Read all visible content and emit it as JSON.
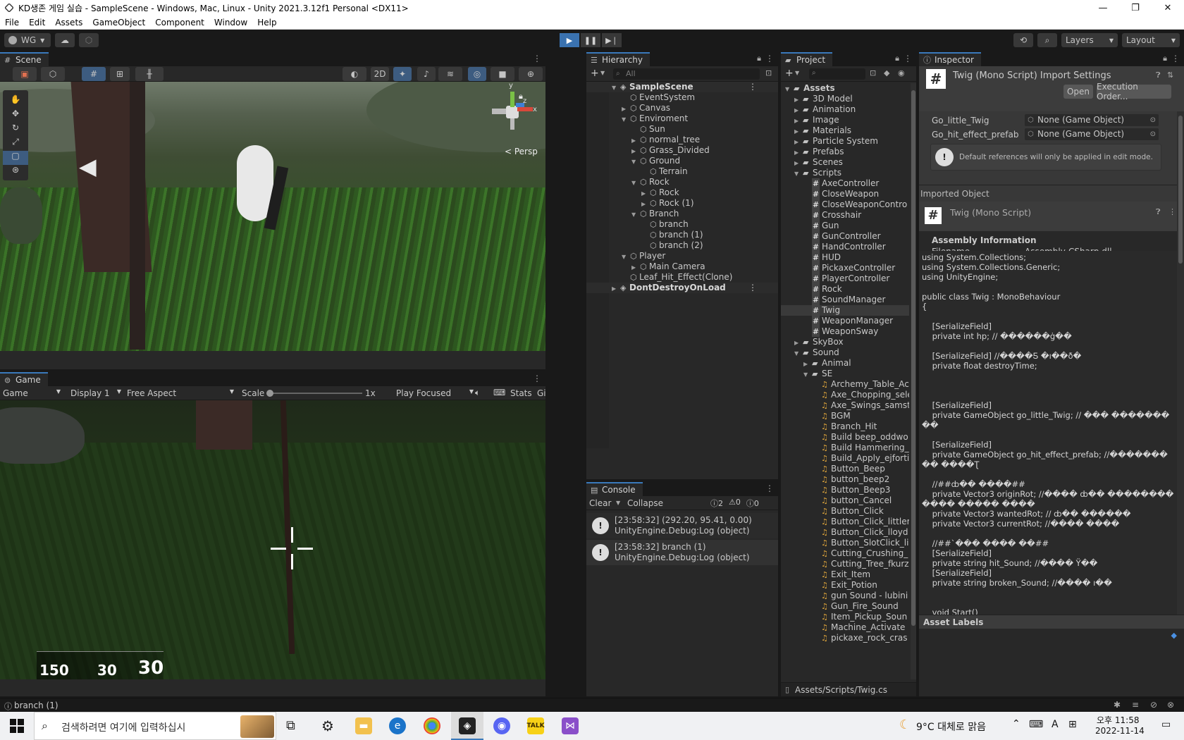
{
  "window": {
    "title": "KD생존 게임 실습 - SampleScene - Windows, Mac, Linux - Unity 2021.3.12f1 Personal <DX11>",
    "minimize": "—",
    "restore": "❐",
    "close": "✕"
  },
  "menu": [
    "File",
    "Edit",
    "Assets",
    "GameObject",
    "Component",
    "Window",
    "Help"
  ],
  "toolbar": {
    "account": "WG",
    "layers": "Layers",
    "layout": "Layout"
  },
  "scene": {
    "tab": "Scene",
    "mode_2d": "2D",
    "persp": "< Persp",
    "gizmo_x": "x",
    "gizmo_y": "y",
    "gizmo_z": "z"
  },
  "game": {
    "tab": "Game",
    "display_mode": "Game",
    "display": "Display 1",
    "aspect": "Free Aspect",
    "scale_label": "Scale",
    "scale_value": "1x",
    "play_focused": "Play Focused",
    "stats": "Stats",
    "gizmos": "Gizmos",
    "hud": {
      "hp": "150",
      "ammo": "30",
      "reserve": "30"
    }
  },
  "hierarchy": {
    "tab": "Hierarchy",
    "search_placeholder": "All",
    "items": [
      {
        "label": "SampleScene",
        "depth": 0,
        "expanded": true,
        "scene": true
      },
      {
        "label": "EventSystem",
        "depth": 1
      },
      {
        "label": "Canvas",
        "depth": 1,
        "collapsed": true
      },
      {
        "label": "Enviroment",
        "depth": 1,
        "expanded": true
      },
      {
        "label": "Sun",
        "depth": 2
      },
      {
        "label": "normal_tree",
        "depth": 2,
        "collapsed": true
      },
      {
        "label": "Grass_Divided",
        "depth": 2,
        "collapsed": true
      },
      {
        "label": "Ground",
        "depth": 2,
        "expanded": true
      },
      {
        "label": "Terrain",
        "depth": 3
      },
      {
        "label": "Rock",
        "depth": 2,
        "expanded": true
      },
      {
        "label": "Rock",
        "depth": 3,
        "collapsed": true
      },
      {
        "label": "Rock (1)",
        "depth": 3,
        "collapsed": true
      },
      {
        "label": "Branch",
        "depth": 2,
        "expanded": true
      },
      {
        "label": "branch",
        "depth": 3
      },
      {
        "label": "branch (1)",
        "depth": 3
      },
      {
        "label": "branch (2)",
        "depth": 3
      },
      {
        "label": "Player",
        "depth": 1,
        "expanded": true
      },
      {
        "label": "Main Camera",
        "depth": 2,
        "collapsed": true
      },
      {
        "label": "Leaf_Hit_Effect(Clone)",
        "depth": 1
      },
      {
        "label": "DontDestroyOnLoad",
        "depth": 0,
        "collapsed": true,
        "scene": true
      }
    ]
  },
  "console": {
    "tab": "Console",
    "clear": "Clear",
    "collapse": "Collapse",
    "count_log": "2",
    "count_warn": "0",
    "count_err": "0",
    "entries": [
      {
        "line1": "[23:58:32] (292.20, 95.41, 0.00)",
        "line2": "UnityEngine.Debug:Log (object)"
      },
      {
        "line1": "[23:58:32] branch (1)",
        "line2": "UnityEngine.Debug:Log (object)"
      }
    ]
  },
  "project": {
    "tab": "Project",
    "root": "Assets",
    "folders": [
      "3D Model",
      "Animation",
      "Image",
      "Materials",
      "Particle System",
      "Prefabs",
      "Scenes",
      "Scripts"
    ],
    "scripts": [
      "AxeController",
      "CloseWeapon",
      "CloseWeaponContro",
      "Crosshair",
      "Gun",
      "GunController",
      "HandController",
      "HUD",
      "PickaxeController",
      "PlayerController",
      "Rock",
      "SoundManager",
      "Twig",
      "WeaponManager",
      "WeaponSway"
    ],
    "folders2": [
      "SkyBox",
      "Sound"
    ],
    "sound_sub": [
      "Animal",
      "SE"
    ],
    "se_files": [
      "Archemy_Table_Ac",
      "Axe_Chopping_sele",
      "Axe_Swings_samst",
      "BGM",
      "Branch_Hit",
      "Build beep_oddwo",
      "Build Hammering_I",
      "Build_Apply_ejforti",
      "Button_Beep",
      "button_beep2",
      "Button_Beep3",
      "button_Cancel",
      "Button_Click",
      "Button_Click_littler",
      "Button_Click_lloyd",
      "Button_SlotClick_li",
      "Cutting_Crushing_",
      "Cutting_Tree_fkurz",
      "Exit_Item",
      "Exit_Potion",
      "gun Sound - lubini",
      "Gun_Fire_Sound",
      "Item_Pickup_Soun",
      "Machine_Activate",
      "pickaxe_rock_cras"
    ],
    "path": "Assets/Scripts/Twig.cs"
  },
  "inspector": {
    "tab": "Inspector",
    "header": "Twig (Mono Script) Import Settings",
    "open": "Open",
    "exec_order": "Execution Order...",
    "fields": [
      {
        "label": "Go_little_Twig",
        "value": "None (Game Object)"
      },
      {
        "label": "Go_hit_effect_prefab",
        "value": "None (Game Object)"
      }
    ],
    "info": "Default references will only be applied in edit mode.",
    "imported": "Imported Object",
    "imported_name": "Twig (Mono Script)",
    "assembly_title": "Assembly Information",
    "filename_label": "Filename",
    "filename_value": "Assembly-CSharp.dll",
    "code": "using System.Collections;\nusing System.Collections.Generic;\nusing UnityEngine;\n\npublic class Twig : MonoBehaviour\n{\n\n    [SerializeField]\n    private int hp; // ������ġ��\n\n    [SerializeField] //����Ƽ �ı��ð�\n    private float destroyTime;\n\n\n\n    [SerializeField]\n    private GameObject go_little_Twig; // ��� �������\n��\n\n    [SerializeField]\n    private GameObject go_hit_effect_prefab; //�������\n�� ����Ʈ\n\n    //##ȸ�� ����##\n    private Vector3 originRot; //���� ȸ�� ��������\n���� ����� ����\n    private Vector3 wantedRot; // ȸ�� ������\n    private Vector3 currentRot; //���� ����\n\n    //##`��� ���� ��##\n    [SerializeField]\n    private string hit_Sound; //���� Ÿ��\n    [SerializeField]\n    private string broken_Sound; //���� ı��\n\n\n    void Start()",
    "asset_labels": "Asset Labels"
  },
  "status": {
    "message": "branch (1)"
  },
  "taskbar": {
    "search_placeholder": "검색하려면 여기에 입력하십시",
    "weather": "9°C  대체로 맑음",
    "ime": "A",
    "time": "오후 11:58",
    "date": "2022-11-14"
  }
}
